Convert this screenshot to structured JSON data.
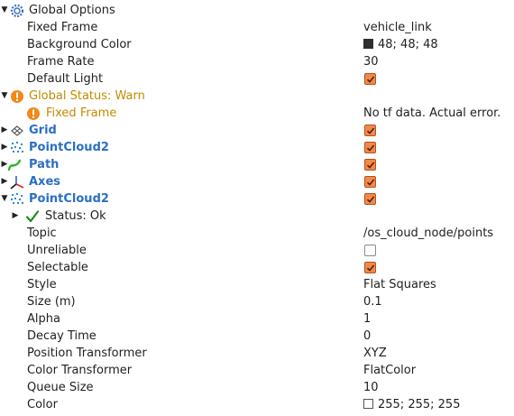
{
  "global_options": {
    "label": "Global Options",
    "fixed_frame": {
      "label": "Fixed Frame",
      "value": "vehicle_link"
    },
    "background_color": {
      "label": "Background Color",
      "value": "48; 48; 48",
      "color": "#303030"
    },
    "frame_rate": {
      "label": "Frame Rate",
      "value": "30"
    },
    "default_light": {
      "label": "Default Light",
      "checked": true
    }
  },
  "global_status": {
    "label": "Global Status: Warn",
    "fixed_frame": {
      "label": "Fixed Frame",
      "value": "No tf data.  Actual error."
    }
  },
  "displays": [
    {
      "label": "Grid",
      "icon": "grid-icon",
      "checked": true
    },
    {
      "label": "PointCloud2",
      "icon": "pointcloud-icon",
      "checked": true
    },
    {
      "label": "Path",
      "icon": "path-icon",
      "checked": true
    },
    {
      "label": "Axes",
      "icon": "axes-icon",
      "checked": true
    },
    {
      "label": "PointCloud2",
      "icon": "pointcloud-icon",
      "checked": true
    }
  ],
  "pointcloud2_expanded": {
    "status": "Status: Ok",
    "properties": [
      {
        "label": "Topic",
        "value": "/os_cloud_node/points"
      },
      {
        "label": "Unreliable",
        "checked": false
      },
      {
        "label": "Selectable",
        "checked": true
      },
      {
        "label": "Style",
        "value": "Flat Squares"
      },
      {
        "label": "Size (m)",
        "value": "0.1"
      },
      {
        "label": "Alpha",
        "value": "1"
      },
      {
        "label": "Decay Time",
        "value": "0"
      },
      {
        "label": "Position Transformer",
        "value": "XYZ"
      },
      {
        "label": "Color Transformer",
        "value": "FlatColor"
      },
      {
        "label": "Queue Size",
        "value": "10"
      },
      {
        "label": "Color",
        "value": "255; 255; 255",
        "color": "#ffffff"
      }
    ]
  },
  "colors": {
    "display_name": "#2a6fc4",
    "warn": "#c48a00",
    "checkbox": "#f08a4b"
  }
}
